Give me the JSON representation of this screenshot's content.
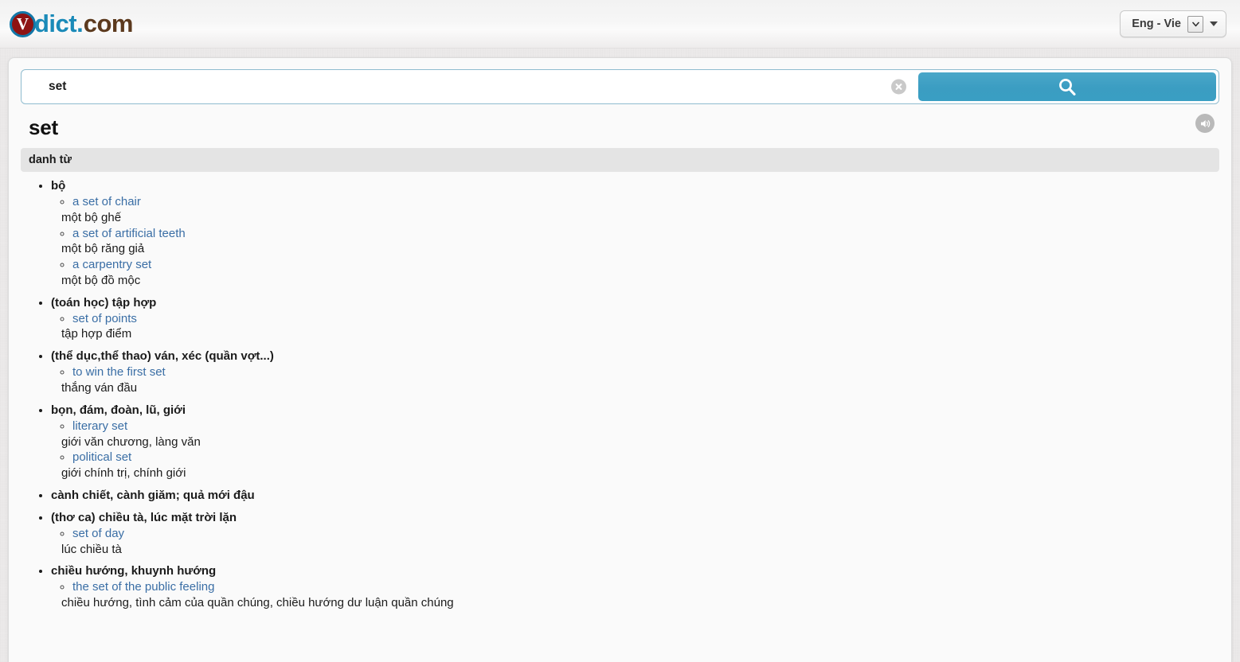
{
  "header": {
    "logo": {
      "badge": "V",
      "dict": "dict",
      "dot": ".",
      "com": "com"
    },
    "lang_selector": {
      "label": "Eng - Vie",
      "combo_icon": "chevron-down-icon",
      "caret_icon": "caret-down-icon"
    }
  },
  "search": {
    "value": "set",
    "placeholder": "",
    "clear_icon": "clear-circle-icon",
    "search_icon": "search-icon"
  },
  "entry": {
    "word": "set",
    "speaker_icon": "speaker-icon",
    "part_of_speech": "danh từ",
    "senses": [
      {
        "meaning": "bộ",
        "examples": [
          {
            "en": "a set of chair",
            "vi": "một bộ ghế"
          },
          {
            "en": "a set of artificial teeth",
            "vi": "một bộ răng giả"
          },
          {
            "en": "a carpentry set",
            "vi": "một bộ đồ mộc"
          }
        ]
      },
      {
        "meaning": "(toán học) tập hợp",
        "examples": [
          {
            "en": "set of points",
            "vi": "tập hợp điểm"
          }
        ]
      },
      {
        "meaning": "(thể dục,thể thao) ván, xéc (quần vợt...)",
        "examples": [
          {
            "en": "to win the first set",
            "vi": "thắng ván đầu"
          }
        ]
      },
      {
        "meaning": "bọn, đám, đoàn, lũ, giới",
        "examples": [
          {
            "en": "literary set",
            "vi": "giới văn chương, làng văn"
          },
          {
            "en": "political set",
            "vi": "giới chính trị, chính giới"
          }
        ]
      },
      {
        "meaning": "cành chiết, cành giăm; quả mới đậu",
        "examples": []
      },
      {
        "meaning": "(thơ ca) chiều tà, lúc mặt trời lặn",
        "examples": [
          {
            "en": "set of day",
            "vi": "lúc chiều tà"
          }
        ]
      },
      {
        "meaning": "chiều hướng, khuynh hướng",
        "examples": [
          {
            "en": "the set of the public feeling",
            "vi": "chiều hướng, tình cảm của quần chúng, chiều hướng dư luận quần chúng"
          }
        ]
      }
    ]
  },
  "colors": {
    "accent_blue": "#3a9ec3",
    "link_blue": "#3a6ea5",
    "logo_blue": "#1a8ab8",
    "logo_red": "#8e1313",
    "logo_brown": "#5c3a1e",
    "pos_bar_bg": "#e4e4e4"
  }
}
